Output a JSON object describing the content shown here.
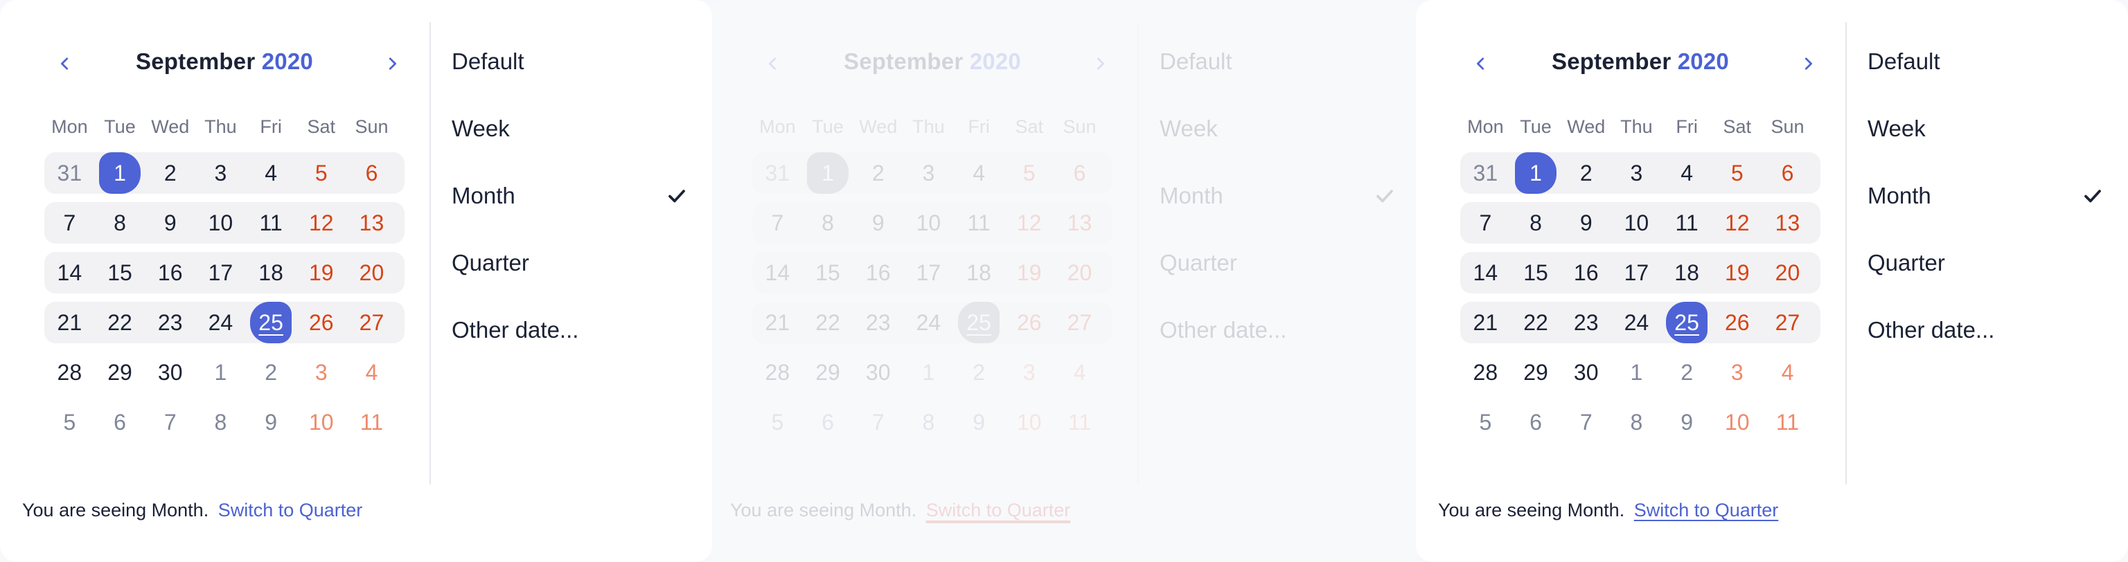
{
  "calendar": {
    "month": "September",
    "year": "2020",
    "weekdays": [
      "Mon",
      "Tue",
      "Wed",
      "Thu",
      "Fri",
      "Sat",
      "Sun"
    ],
    "weeks": [
      [
        "31",
        "1",
        "2",
        "3",
        "4",
        "5",
        "6"
      ],
      [
        "7",
        "8",
        "9",
        "10",
        "11",
        "12",
        "13"
      ],
      [
        "14",
        "15",
        "16",
        "17",
        "18",
        "19",
        "20"
      ],
      [
        "21",
        "22",
        "23",
        "24",
        "25",
        "26",
        "27"
      ],
      [
        "28",
        "29",
        "30",
        "1",
        "2",
        "3",
        "4"
      ],
      [
        "5",
        "6",
        "7",
        "8",
        "9",
        "10",
        "11"
      ]
    ],
    "range_start": "1",
    "range_end": "25"
  },
  "menu": {
    "items": [
      "Default",
      "Week",
      "Month",
      "Quarter",
      "Other date..."
    ],
    "checked": "Month"
  },
  "footer": {
    "status": "You are seeing Month.",
    "link": "Switch to Quarter"
  },
  "colors": {
    "accent": "#4e63d6",
    "weekend": "#d84315",
    "text": "#1b2235",
    "row_bg": "#f2f2f4"
  },
  "icons": {
    "prev": "chevron-left-icon",
    "next": "chevron-right-icon",
    "check": "checkmark-icon"
  }
}
